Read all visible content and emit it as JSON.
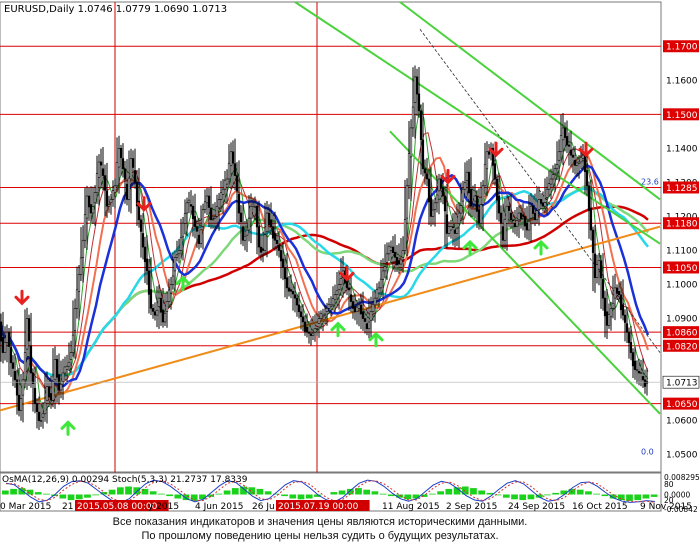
{
  "chart_data": [
    {
      "type": "candlestick",
      "symbol_header": "EURUSD,Daily  1.0746 1.0779 1.0690 1.0713",
      "ohlc_last": {
        "open": 1.0746,
        "high": 1.0779,
        "low": 1.069,
        "close": 1.0713
      },
      "current_price_label": "1.0713",
      "y_range": [
        1.0455,
        1.183
      ],
      "y_ticks": [
        "1.1600",
        "1.1500",
        "1.1400",
        "1.1300",
        "1.1200",
        "1.1100",
        "1.1000",
        "1.0900",
        "1.0800",
        "1.0700",
        "1.0600",
        "1.0500",
        "1.1700",
        "1.1285",
        "1.1180",
        "1.1050",
        "1.0860",
        "1.0820",
        "1.0650"
      ],
      "y_ticks_plain": [
        "1.1600",
        "1.1400",
        "1.1300",
        "1.1200",
        "1.1100",
        "1.1000",
        "1.0900",
        "1.0600",
        "1.0500"
      ],
      "levels": [
        {
          "value": 1.17,
          "label": "1.1700"
        },
        {
          "value": 1.15,
          "label": "1.1500"
        },
        {
          "value": 1.1285,
          "label": "1.1285"
        },
        {
          "value": 1.118,
          "label": "1.1180"
        },
        {
          "value": 1.105,
          "label": "1.1050"
        },
        {
          "value": 1.086,
          "label": "1.0860"
        },
        {
          "value": 1.082,
          "label": "1.0820"
        },
        {
          "value": 1.065,
          "label": "1.0650"
        }
      ],
      "level_color": "#dd0000",
      "x_labels": [
        "0 Mar 2015",
        "21",
        "2015.05.08 00:00",
        "y 2015",
        "4 Jun 2015",
        "26 Ju",
        "2015.07.19 00:00",
        "11 Aug 2015",
        "2 Sep 2015",
        "24 Sep 2015",
        "16 Oct 2015",
        "9 Nov 2015"
      ],
      "x_labels_highlighted": [
        "2015.05.08 00:00",
        "2015.07.19 00:00"
      ],
      "close_path": [
        [
          0,
          1.089
        ],
        [
          4,
          1.08
        ],
        [
          8,
          1.086
        ],
        [
          12,
          1.077
        ],
        [
          16,
          1.072
        ],
        [
          20,
          1.063
        ],
        [
          24,
          1.072
        ],
        [
          28,
          1.09
        ],
        [
          32,
          1.074
        ],
        [
          36,
          1.065
        ],
        [
          40,
          1.06
        ],
        [
          44,
          1.062
        ],
        [
          48,
          1.07
        ],
        [
          52,
          1.066
        ],
        [
          56,
          1.078
        ],
        [
          60,
          1.069
        ],
        [
          64,
          1.074
        ],
        [
          68,
          1.076
        ],
        [
          72,
          1.08
        ],
        [
          76,
          1.093
        ],
        [
          80,
          1.103
        ],
        [
          84,
          1.113
        ],
        [
          88,
          1.126
        ],
        [
          92,
          1.121
        ],
        [
          96,
          1.127
        ],
        [
          100,
          1.136
        ],
        [
          104,
          1.132
        ],
        [
          108,
          1.123
        ],
        [
          112,
          1.125
        ],
        [
          116,
          1.129
        ],
        [
          120,
          1.14
        ],
        [
          124,
          1.134
        ],
        [
          128,
          1.125
        ],
        [
          132,
          1.137
        ],
        [
          136,
          1.13
        ],
        [
          140,
          1.119
        ],
        [
          144,
          1.111
        ],
        [
          148,
          1.104
        ],
        [
          152,
          1.093
        ],
        [
          156,
          1.091
        ],
        [
          160,
          1.096
        ],
        [
          164,
          1.089
        ],
        [
          168,
          1.095
        ],
        [
          172,
          1.1
        ],
        [
          176,
          1.108
        ],
        [
          180,
          1.11
        ],
        [
          184,
          1.118
        ],
        [
          188,
          1.124
        ],
        [
          192,
          1.123
        ],
        [
          196,
          1.117
        ],
        [
          200,
          1.112
        ],
        [
          204,
          1.122
        ],
        [
          208,
          1.126
        ],
        [
          212,
          1.119
        ],
        [
          216,
          1.12
        ],
        [
          220,
          1.125
        ],
        [
          224,
          1.128
        ],
        [
          228,
          1.131
        ],
        [
          232,
          1.139
        ],
        [
          236,
          1.132
        ],
        [
          240,
          1.121
        ],
        [
          244,
          1.113
        ],
        [
          248,
          1.116
        ],
        [
          252,
          1.123
        ],
        [
          256,
          1.123
        ],
        [
          260,
          1.111
        ],
        [
          264,
          1.11
        ],
        [
          268,
          1.121
        ],
        [
          272,
          1.117
        ],
        [
          276,
          1.113
        ],
        [
          280,
          1.11
        ],
        [
          284,
          1.105
        ],
        [
          288,
          1.099
        ],
        [
          292,
          1.098
        ],
        [
          296,
          1.096
        ],
        [
          300,
          1.092
        ],
        [
          304,
          1.089
        ],
        [
          308,
          1.086
        ],
        [
          312,
          1.085
        ],
        [
          316,
          1.087
        ],
        [
          320,
          1.09
        ],
        [
          324,
          1.091
        ],
        [
          328,
          1.093
        ],
        [
          332,
          1.094
        ],
        [
          336,
          1.097
        ],
        [
          340,
          1.1
        ],
        [
          344,
          1.104
        ],
        [
          348,
          1.099
        ],
        [
          352,
          1.095
        ],
        [
          356,
          1.092
        ],
        [
          360,
          1.094
        ],
        [
          364,
          1.09
        ],
        [
          368,
          1.087
        ],
        [
          372,
          1.092
        ],
        [
          376,
          1.096
        ],
        [
          380,
          1.099
        ],
        [
          384,
          1.104
        ],
        [
          388,
          1.109
        ],
        [
          392,
          1.111
        ],
        [
          396,
          1.108
        ],
        [
          400,
          1.106
        ],
        [
          404,
          1.11
        ],
        [
          408,
          1.129
        ],
        [
          412,
          1.146
        ],
        [
          416,
          1.161
        ],
        [
          420,
          1.151
        ],
        [
          424,
          1.134
        ],
        [
          428,
          1.131
        ],
        [
          432,
          1.12
        ],
        [
          436,
          1.124
        ],
        [
          440,
          1.131
        ],
        [
          444,
          1.126
        ],
        [
          448,
          1.115
        ],
        [
          452,
          1.117
        ],
        [
          456,
          1.115
        ],
        [
          460,
          1.121
        ],
        [
          464,
          1.128
        ],
        [
          468,
          1.133
        ],
        [
          472,
          1.123
        ],
        [
          476,
          1.126
        ],
        [
          480,
          1.118
        ],
        [
          484,
          1.129
        ],
        [
          488,
          1.139
        ],
        [
          492,
          1.14
        ],
        [
          496,
          1.131
        ],
        [
          500,
          1.121
        ],
        [
          504,
          1.113
        ],
        [
          508,
          1.123
        ],
        [
          512,
          1.119
        ],
        [
          516,
          1.117
        ],
        [
          520,
          1.121
        ],
        [
          524,
          1.12
        ],
        [
          528,
          1.116
        ],
        [
          532,
          1.123
        ],
        [
          536,
          1.119
        ],
        [
          540,
          1.125
        ],
        [
          544,
          1.123
        ],
        [
          548,
          1.128
        ],
        [
          552,
          1.131
        ],
        [
          556,
          1.134
        ],
        [
          560,
          1.139
        ],
        [
          564,
          1.146
        ],
        [
          568,
          1.141
        ],
        [
          572,
          1.138
        ],
        [
          576,
          1.135
        ],
        [
          580,
          1.136
        ],
        [
          584,
          1.138
        ],
        [
          588,
          1.129
        ],
        [
          592,
          1.116
        ],
        [
          596,
          1.102
        ],
        [
          600,
          1.107
        ],
        [
          604,
          1.096
        ],
        [
          608,
          1.088
        ],
        [
          612,
          1.093
        ],
        [
          616,
          1.099
        ],
        [
          620,
          1.097
        ],
        [
          624,
          1.091
        ],
        [
          628,
          1.086
        ],
        [
          632,
          1.08
        ],
        [
          636,
          1.075
        ],
        [
          640,
          1.074
        ],
        [
          644,
          1.072
        ],
        [
          648,
          1.071
        ]
      ],
      "arrows_down": [
        [
          22,
          1.0945
        ],
        [
          144,
          1.122
        ],
        [
          347,
          1.1015
        ],
        [
          448,
          1.13
        ],
        [
          496,
          1.138
        ],
        [
          586,
          1.138
        ]
      ],
      "arrows_up": [
        [
          68,
          1.0595
        ],
        [
          183,
          1.102
        ],
        [
          338,
          1.0885
        ],
        [
          376,
          1.0855
        ],
        [
          470,
          1.1125
        ],
        [
          541,
          1.1125
        ]
      ],
      "trend_lines": [
        {
          "from": [
            0,
            1.063
          ],
          "to": [
            660,
            1.117
          ],
          "color": "#f08c1a"
        }
      ],
      "channel_lines": [
        {
          "from": [
            295,
            1.183
          ],
          "to": [
            660,
            1.112
          ],
          "color": "#4ad23c"
        },
        {
          "from": [
            400,
            1.183
          ],
          "to": [
            660,
            1.125
          ],
          "color": "#4ad23c"
        },
        {
          "from": [
            390,
            1.145
          ],
          "to": [
            660,
            1.062
          ],
          "color": "#4ad23c"
        },
        {
          "from": [
            420,
            1.175
          ],
          "to": [
            660,
            1.08
          ],
          "color": "#2a2a2a",
          "dashed": true
        }
      ],
      "vertical_markers": [
        115,
        317
      ],
      "right_text": [
        {
          "y": 1.1302,
          "label": "23.6"
        },
        {
          "y": 1.051,
          "label": "0.0"
        }
      ],
      "ma_colors": {
        "red": "#d00000",
        "green": "#7ed87a",
        "cyan": "#28d8e8",
        "salmon": "#f07050",
        "blue": "#1a30d8",
        "thin_red": "#c03030",
        "thin_green": "#30a030"
      }
    },
    {
      "type": "oscillator",
      "osma_label": "OsMA(12,26,9)",
      "osma_value": "0.00294",
      "stoch_label": "Stoch(5,3,3)",
      "stoch_values": "21.2737 17.8339",
      "y_tick_labels": [
        "0.008295",
        "80",
        "20",
        "0.0000",
        "-0.00842"
      ],
      "osma": [
        0.5,
        0.7,
        0.8,
        0.6,
        0.3,
        0.1,
        -0.2,
        -0.5,
        -0.7,
        -0.6,
        -0.4,
        -0.1,
        0.3,
        0.6,
        0.9,
        1.0,
        0.9,
        0.7,
        0.4,
        0.1,
        -0.2,
        -0.5,
        -0.7,
        -0.8,
        -0.6,
        -0.3,
        0.1,
        0.5,
        0.8,
        1.0,
        0.9,
        0.7,
        0.4,
        0.1,
        -0.2,
        -0.5,
        -0.6,
        -0.5,
        -0.3,
        0.0,
        0.3,
        0.5,
        0.7,
        0.8,
        0.6,
        0.4,
        0.1,
        -0.2,
        -0.4,
        -0.6,
        -0.5,
        -0.3,
        0.1,
        0.4,
        0.7,
        0.9,
        1.0,
        0.8,
        0.5,
        0.2,
        -0.1,
        -0.4,
        -0.6,
        -0.7,
        -0.6,
        -0.4,
        -0.1,
        0.2,
        0.5,
        0.7,
        0.6,
        0.4,
        0.1,
        -0.2,
        -0.5,
        -0.7,
        -0.8,
        -0.7,
        -0.5,
        -0.3
      ],
      "stoch_main": [
        80,
        75,
        55,
        35,
        20,
        25,
        45,
        70,
        85,
        88,
        80,
        60,
        40,
        22,
        18,
        30,
        55,
        78,
        90,
        85,
        70,
        50,
        30,
        20,
        28,
        50,
        72,
        88,
        82,
        60,
        38,
        24,
        30,
        52,
        75,
        88,
        84,
        65,
        42,
        26,
        20,
        34,
        58,
        80,
        90,
        86,
        70,
        48,
        30,
        22,
        30,
        52,
        74,
        86,
        80,
        62,
        40,
        26,
        22,
        38,
        60,
        80,
        88,
        78,
        56,
        34,
        22,
        26,
        44,
        66,
        82,
        84,
        70,
        50,
        32,
        22,
        18,
        20,
        24,
        21
      ],
      "stoch_signal": [
        78,
        78,
        65,
        45,
        28,
        24,
        35,
        58,
        76,
        86,
        84,
        70,
        50,
        30,
        20,
        24,
        42,
        66,
        84,
        88,
        78,
        60,
        40,
        25,
        24,
        38,
        60,
        80,
        86,
        72,
        50,
        30,
        26,
        40,
        64,
        82,
        86,
        76,
        54,
        34,
        22,
        28,
        46,
        70,
        86,
        88,
        78,
        60,
        40,
        26,
        26,
        42,
        64,
        80,
        84,
        72,
        52,
        34,
        24,
        30,
        50,
        70,
        84,
        84,
        68,
        46,
        28,
        24,
        34,
        56,
        74,
        84,
        78,
        60,
        42,
        28,
        22,
        20,
        22,
        18
      ]
    }
  ],
  "disclaimer": [
    "Все показания индикаторов и значения цены являются историческими данными.",
    "По прошлому поведению цены нельзя судить о будущих результатах."
  ]
}
